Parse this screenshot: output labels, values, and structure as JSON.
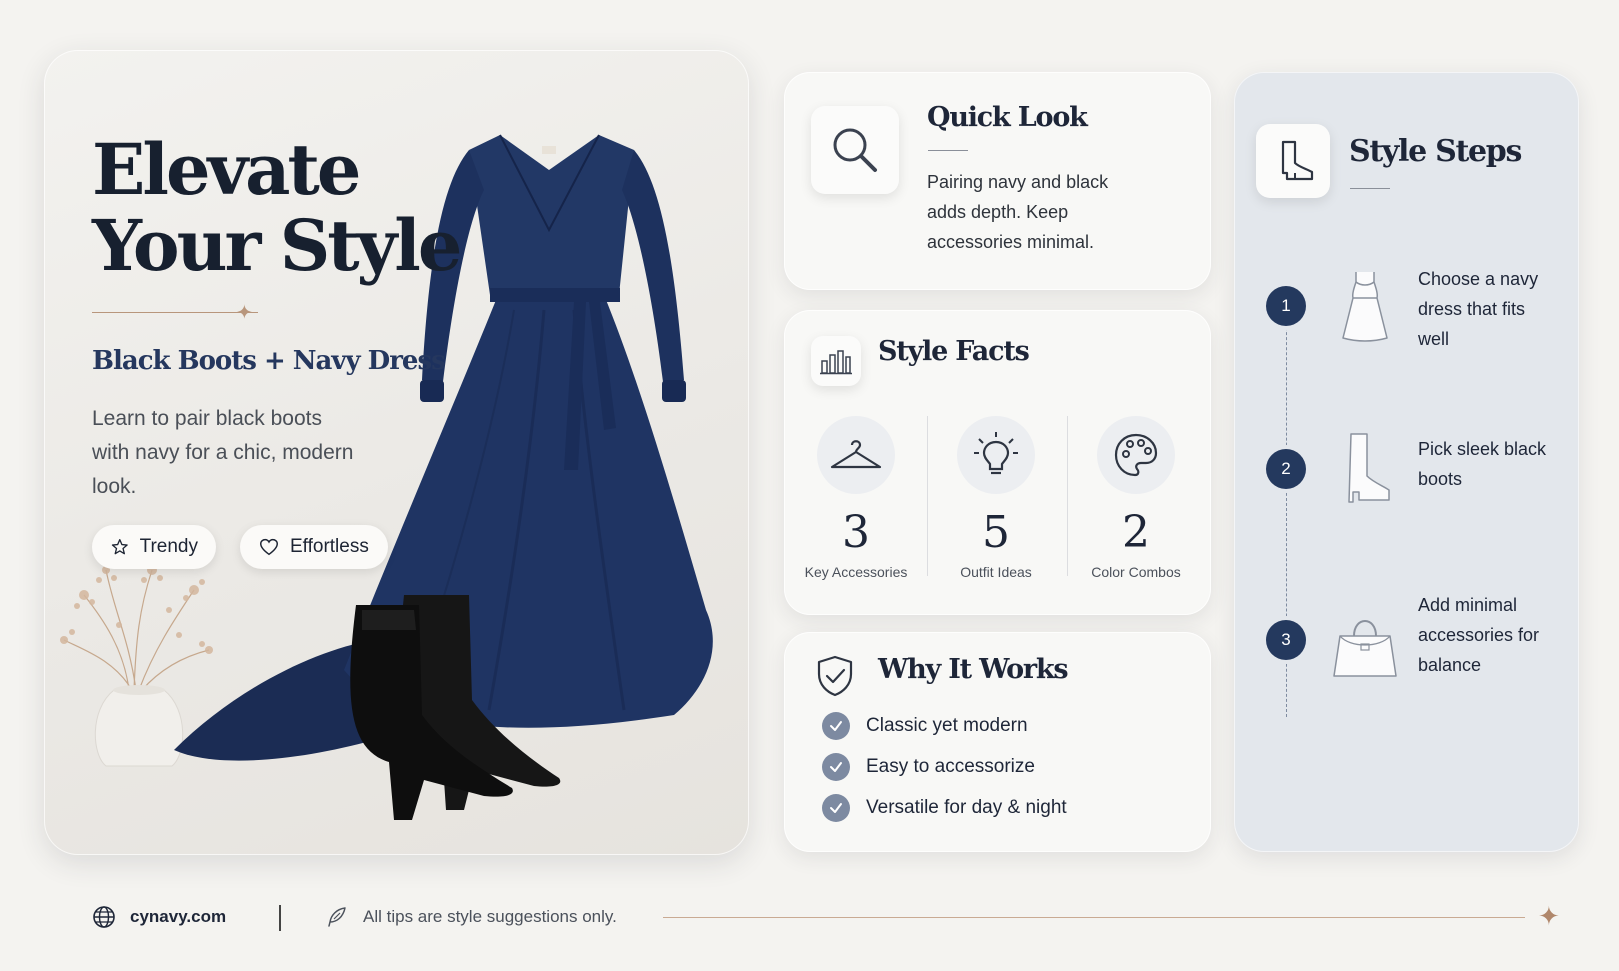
{
  "hero": {
    "title": "Elevate\nYour Style",
    "subtitle": "Black Boots + Navy Dress",
    "description": "Learn to pair black boots with navy for a chic, modern look.",
    "chips": [
      {
        "label": "Trendy",
        "icon": "star-icon"
      },
      {
        "label": "Effortless",
        "icon": "heart-icon"
      }
    ]
  },
  "quick_look": {
    "title": "Quick Look",
    "icon": "search-icon",
    "text": "Pairing navy and black adds depth. Keep accessories minimal."
  },
  "style_facts": {
    "title": "Style Facts",
    "icon": "bar-chart-icon",
    "stats": [
      {
        "value": "3",
        "label": "Key Accessories",
        "icon": "hanger-icon"
      },
      {
        "value": "5",
        "label": "Outfit Ideas",
        "icon": "lightbulb-icon"
      },
      {
        "value": "2",
        "label": "Color Combos",
        "icon": "palette-icon"
      }
    ]
  },
  "why_it_works": {
    "title": "Why It Works",
    "icon": "shield-check-icon",
    "items": [
      "Classic yet modern",
      "Easy to accessorize",
      "Versatile for day & night"
    ]
  },
  "style_steps": {
    "title": "Style Steps",
    "icon": "boot-icon",
    "steps": [
      {
        "num": "1",
        "text": "Choose a navy dress that fits well",
        "icon": "dress-icon"
      },
      {
        "num": "2",
        "text": "Pick sleek black boots",
        "icon": "boot-icon"
      },
      {
        "num": "3",
        "text": "Add minimal accessories for balance",
        "icon": "handbag-icon"
      }
    ]
  },
  "footer": {
    "site": "cynavy.com",
    "note": "All tips are style suggestions only."
  },
  "colors": {
    "navy": "#24395e",
    "accent": "#b8967c",
    "check": "#7d8aa1",
    "panel": "#e3e7ec"
  }
}
